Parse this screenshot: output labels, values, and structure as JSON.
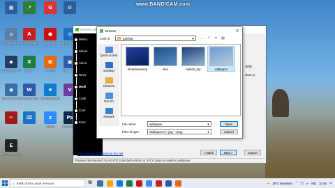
{
  "watermark": "www.BANDICAM.com",
  "desktop": {
    "icons": [
      {
        "label": "",
        "color": "#2c5ea0",
        "glyph": "▦"
      },
      {
        "label": "",
        "color": "#2e7d32",
        "glyph": "↗"
      },
      {
        "label": "",
        "color": "#dd3333",
        "glyph": "G"
      },
      {
        "label": "",
        "color": "#2e5d9a",
        "glyph": "⚙"
      },
      {
        "label": "ProfileSyste...",
        "color": "#5a7fa8",
        "glyph": "⌂"
      },
      {
        "label": "Adobe Reader",
        "color": "#c81e1e",
        "glyph": "A"
      },
      {
        "label": "Bandicam",
        "color": "#cc1111",
        "glyph": "●"
      },
      {
        "label": "Screen Creator",
        "color": "#1d6fc2",
        "glyph": "◎"
      },
      {
        "label": "Cisco Packet Tracer",
        "color": "#243b63",
        "glyph": "◆"
      },
      {
        "label": "Excel",
        "color": "#1e7b45",
        "glyph": "X"
      },
      {
        "label": "XAMPP",
        "color": "#e26a10",
        "glyph": "⊠"
      },
      {
        "label": "VirtualBox",
        "color": "#2a5ca8",
        "glyph": "▣"
      },
      {
        "label": "Corel CAPTURE",
        "color": "#3a6ea5",
        "glyph": "◉"
      },
      {
        "label": "Microsoft Word 2016",
        "color": "#2b5aa8",
        "glyph": "W"
      },
      {
        "label": "Microsoft Edge",
        "color": "#0f7bd1",
        "glyph": "e"
      },
      {
        "label": "",
        "color": "#6a3fa0",
        "glyph": "V"
      },
      {
        "label": "",
        "color": "#a01c1c",
        "glyph": "✂"
      },
      {
        "label": "",
        "color": "#1a73c9",
        "glyph": "⌧"
      },
      {
        "label": "Zoom",
        "color": "#2d8cff",
        "glyph": "z"
      },
      {
        "label": "Photoshop",
        "color": "#0b2a4d",
        "glyph": "Ps"
      },
      {
        "label": "Epic Games Launcher",
        "color": "#222222",
        "glyph": "E"
      }
    ]
  },
  "wizard": {
    "title": "Ubuntu Linux Installer",
    "steps": [
      "Welco",
      "Select",
      "Add u",
      "Reco",
      "Modi",
      "Confi",
      "Conf",
      "Exec"
    ],
    "link": "Boot options explained on the net",
    "status": "Replace the standard GLAX KDE (standard edition) or XFCE (popcorn edition) wallpaper",
    "back_label": "< Back",
    "next_label": "Next >",
    "cancel_label": "Cancel",
    "right_labels": [
      "ckfile",
      "stom.rc"
    ]
  },
  "browse": {
    "title": "Browse",
    "close_glyph": "✕",
    "lookin_label": "Look in:",
    "lookin_value": "gambar",
    "places": [
      {
        "label": "Quick access",
        "color": "#4a90d9"
      },
      {
        "label": "Desktop",
        "color": "#2d6ec9"
      },
      {
        "label": "Libraries",
        "color": "#e0b040"
      },
      {
        "label": "This PC",
        "color": "#4a8fd9"
      },
      {
        "label": "Network",
        "color": "#3a7fc9"
      }
    ],
    "files": [
      {
        "name": "shutdownkong",
        "colors": [
          "#1c3f9a",
          "#0b1f5a"
        ]
      },
      {
        "name": "slax",
        "colors": [
          "#1d4d8a",
          "#5a8dbf"
        ]
      },
      {
        "name": "splash_top",
        "colors": [
          "#1a3f7a",
          "#9ab7d5"
        ]
      },
      {
        "name": "wallpaper",
        "colors": [
          "#6d9ed0",
          "#b8c9d9"
        ]
      }
    ],
    "filename_label": "File name:",
    "filename_value": "wallpaper",
    "filetype_label": "Files of type:",
    "filetype_value": "Wallpapers (*.jpg; *.png)",
    "open_label": "Open",
    "cancel_label": "Cancel"
  },
  "taskbar": {
    "search_placeholder": "Ketik di sini untuk mencari",
    "apps": [
      "#3a6ea5",
      "#f0a800",
      "#0f7bd1",
      "#1e7b45",
      "#cc1111",
      "#2d8cff",
      "#c81e1e",
      "#2b5aa8",
      "#e26a10"
    ],
    "weather": "29°C Berawan",
    "language": "IND",
    "time": "10:45",
    "date": ""
  }
}
